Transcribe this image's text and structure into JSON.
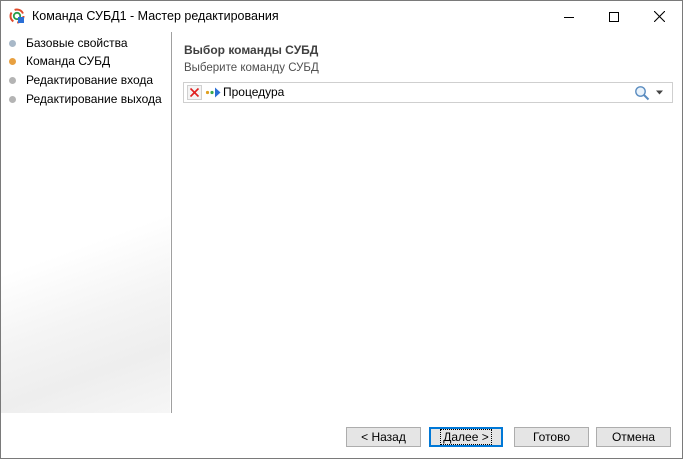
{
  "window": {
    "title": "Команда СУБД1 - Мастер редактирования",
    "icon": "wizard-app-icon"
  },
  "steps": [
    {
      "label": "Базовые свойства",
      "state": "done"
    },
    {
      "label": "Команда СУБД",
      "state": "active"
    },
    {
      "label": "Редактирование входа",
      "state": "pending"
    },
    {
      "label": "Редактирование выхода",
      "state": "pending"
    }
  ],
  "main": {
    "section_title": "Выбор команды СУБД",
    "section_subtitle": "Выберите команду СУБД",
    "command_field": {
      "value": "Процедура",
      "clear_icon": "red-x-icon",
      "item_icon": "procedure-icon",
      "search_icon": "magnifier-icon",
      "dropdown_icon": "chevron-down-icon"
    }
  },
  "buttons": {
    "back": "< Назад",
    "next": "Далее >",
    "finish": "Готово",
    "cancel": "Отмена"
  },
  "colors": {
    "active_step": "#e8a040",
    "done_step": "#a8b8c8",
    "pending_step": "#b4b4b4",
    "clear_icon": "#e02020",
    "focus_border": "#0078d7"
  }
}
